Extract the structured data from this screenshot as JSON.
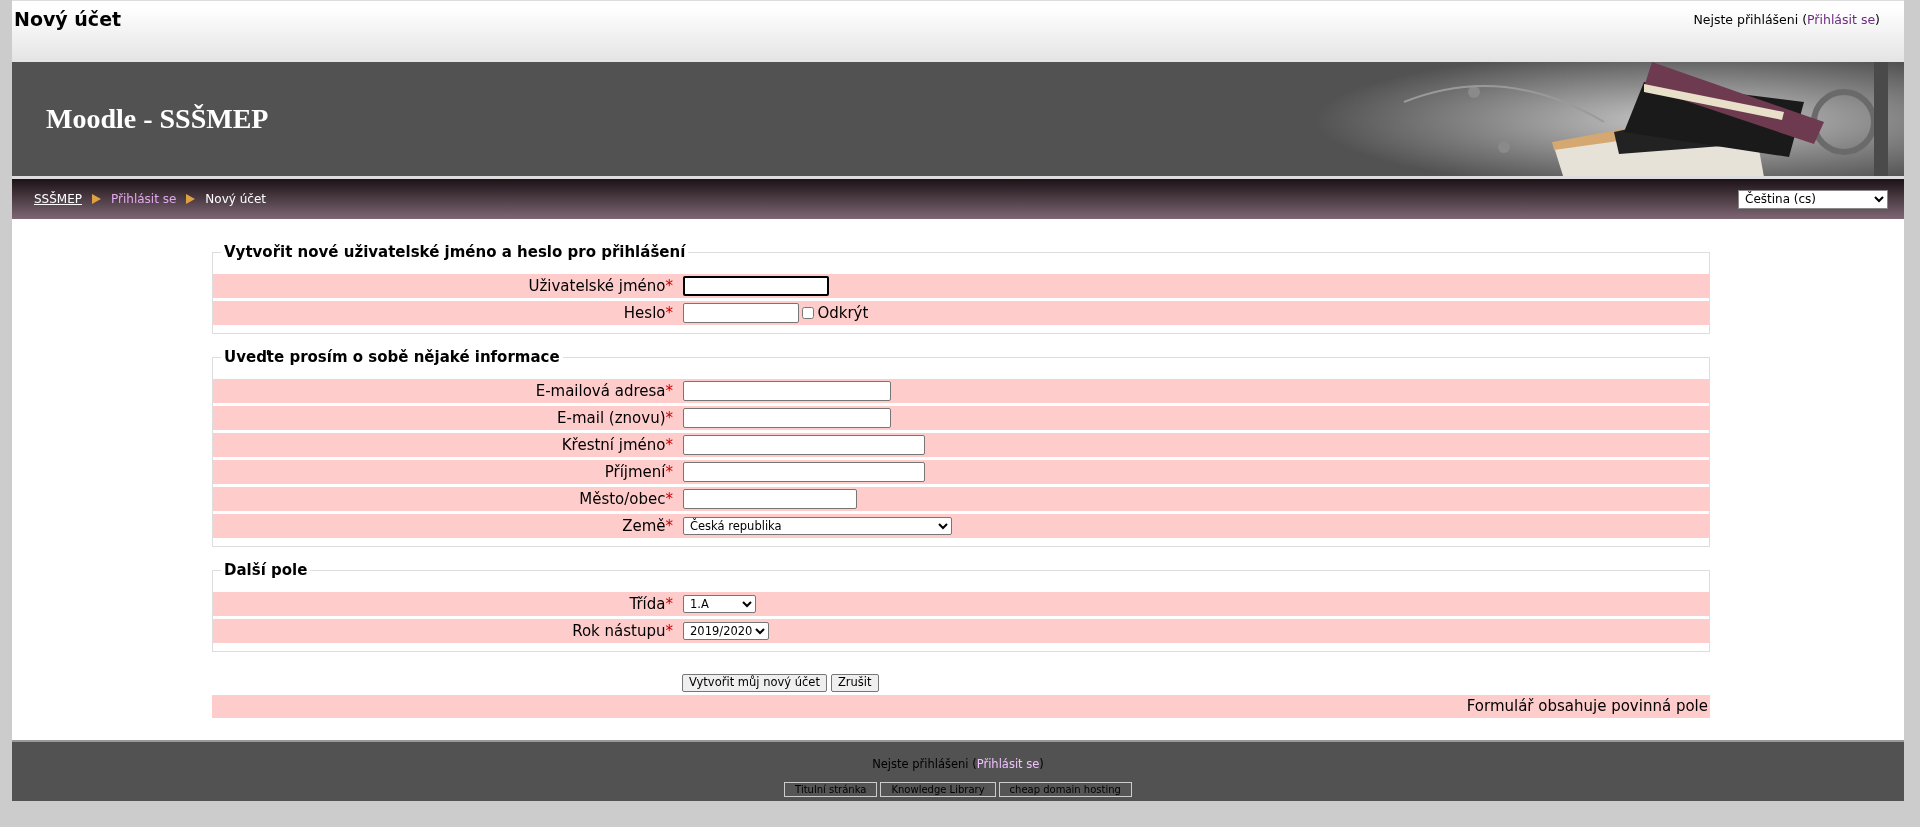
{
  "header": {
    "title": "Nový účet",
    "login_text": "Nejste přihlášeni",
    "login_open": "(",
    "login_link": "Přihlásit se",
    "login_close": ")"
  },
  "banner": {
    "title": "Moodle - SSŠMEP",
    "kind": "picture"
  },
  "breadcrumb": [
    {
      "label": "SSŠMEP",
      "kind": "home"
    },
    {
      "label": "Přihlásit se",
      "kind": "link"
    },
    {
      "label": "Nový účet",
      "kind": "current"
    }
  ],
  "language_select": {
    "value": "Čeština (cs)"
  },
  "fieldsets": [
    {
      "legend": "Vytvořit nové uživatelské jméno a heslo pro přihlášení",
      "fields": [
        {
          "label": "Uživatelské jméno",
          "required_mark": "*",
          "kind": "text",
          "focused": true
        },
        {
          "label": "Heslo",
          "required_mark": "*",
          "kind": "password",
          "focused": false,
          "reveal": {
            "label": "Odkrýt",
            "checked": false
          }
        }
      ]
    },
    {
      "legend": "Uveďte prosím o sobě nějaké informace",
      "fields": [
        {
          "label": "E-mailová adresa",
          "required_mark": "*",
          "kind": "text",
          "focused": false
        },
        {
          "label": "E-mail (znovu)",
          "required_mark": "*",
          "kind": "text",
          "focused": false
        },
        {
          "label": "Křestní jméno",
          "required_mark": "*",
          "kind": "text",
          "focused": false
        },
        {
          "label": "Příjmení",
          "required_mark": "*",
          "kind": "text",
          "focused": false
        },
        {
          "label": "Město/obec",
          "required_mark": "*",
          "kind": "text",
          "focused": false
        },
        {
          "label": "Země",
          "required_mark": "*",
          "kind": "select",
          "value": "Česká republika"
        }
      ]
    },
    {
      "legend": "Další pole",
      "fields": [
        {
          "label": "Třída",
          "required_mark": "*",
          "kind": "select",
          "value": "1.A"
        },
        {
          "label": "Rok nástupu",
          "required_mark": "*",
          "kind": "select",
          "value": "2019/2020"
        }
      ]
    }
  ],
  "buttons": [
    {
      "label": "Vytvořit můj nový účet"
    },
    {
      "label": "Zrušit"
    }
  ],
  "required_note": "Formulář obsahuje povinná pole",
  "footer": {
    "login_text": "Nejste přihlášeni",
    "login_open": "(",
    "login_link": "Přihlásit se",
    "login_close": ")",
    "links": [
      "Titulní stránka",
      "Knowledge Library",
      "cheap domain hosting"
    ]
  }
}
